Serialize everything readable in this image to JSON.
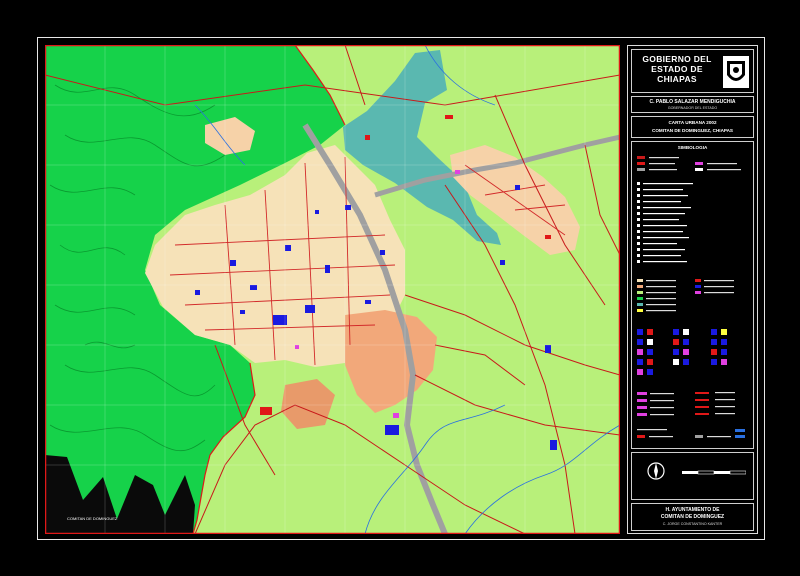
{
  "title_block": {
    "government": "GOBIERNO DEL ESTADO DE CHIAPAS",
    "governor": "C. PABLO SALAZAR MENDIGUCHIA",
    "governor_role": "GOBERNADOR DEL ESTADO",
    "map_title": "CARTA URBANA 2002",
    "municipality": "COMITAN DE DOMINGUEZ, CHIAPAS",
    "legend_heading": "SIMBOLOGIA",
    "ayuntamiento": "H. AYUNTAMIENTO DE",
    "ayuntamiento_city": "COMITAN DE DOMINGUEZ",
    "president": "C. JORGE CONSTANTINO KANTER",
    "map_corner_label": "COMITAN DE DOMINGUEZ"
  },
  "colors": {
    "forest": "#16d24a",
    "agriculture": "#b8f07a",
    "urban": "#f6e2b8",
    "commercial": "#f2a87a",
    "water": "#5ab8b0",
    "roads": "#c81a1a",
    "equipment": "#1a1ae0",
    "highway": "#a0a0a0"
  },
  "icons": [
    "state-seal-icon",
    "north-arrow-icon",
    "scale-bar-icon"
  ]
}
